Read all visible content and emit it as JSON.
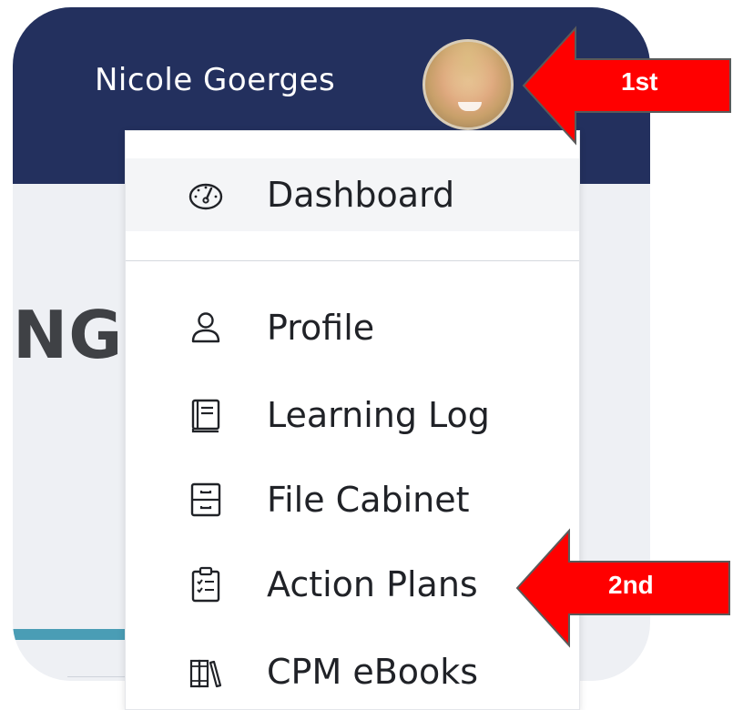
{
  "header": {
    "user_name": "Nicole Goerges"
  },
  "page": {
    "heading_fragment": "NG"
  },
  "menu": {
    "items": [
      {
        "label": "Dashboard",
        "icon": "dashboard-gauge-icon",
        "active": true
      },
      {
        "label": "Profile",
        "icon": "person-icon"
      },
      {
        "label": "Learning Log",
        "icon": "notebook-icon"
      },
      {
        "label": "File Cabinet",
        "icon": "file-cabinet-icon"
      },
      {
        "label": "Action Plans",
        "icon": "clipboard-checklist-icon"
      },
      {
        "label": "CPM eBooks",
        "icon": "books-icon"
      }
    ]
  },
  "annotations": {
    "first": "1st",
    "second": "2nd",
    "arrow_color": "#ff0000"
  },
  "colors": {
    "header_bg": "#23305e",
    "content_bg": "#eef0f4",
    "accent": "#4a9db5"
  }
}
